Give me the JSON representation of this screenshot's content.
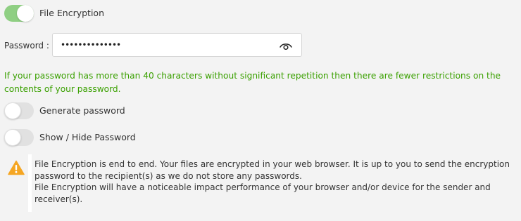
{
  "encryption": {
    "toggle_state": "on",
    "label": "File Encryption"
  },
  "password": {
    "label": "Password :",
    "value": "••••••••••••••",
    "visibility_icon": "eye-icon"
  },
  "hint": "If your password has more than 40 characters without significant repetition then there are fewer restrictions on the contents of your password.",
  "generate": {
    "toggle_state": "off",
    "label": "Generate password"
  },
  "show_hide": {
    "toggle_state": "off",
    "label": "Show / Hide Password"
  },
  "notice": {
    "icon": "warning-icon",
    "line1": "File Encryption is end to end. Your files are encrypted in your web browser. It is up to you to send the encryption password to the recipient(s) as we do not store any passwords.",
    "line2": "File Encryption will have a noticeable impact performance of your browser and/or device for the sender and receiver(s)."
  },
  "colors": {
    "toggle_on": "#8fcf83",
    "toggle_off": "#e1e1e1",
    "hint_text": "#3aa000",
    "warning": "#f5a623",
    "background": "#f3f3f3"
  }
}
